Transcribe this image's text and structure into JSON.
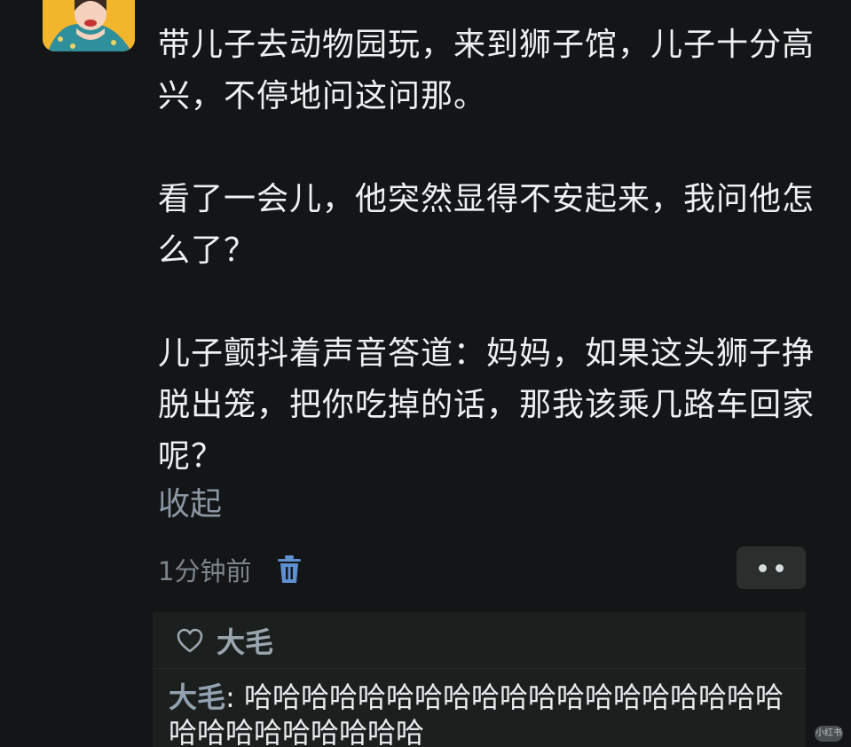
{
  "post": {
    "paragraphs": [
      "带儿子去动物园玩，来到狮子馆，儿子十分高兴，不停地问这问那。",
      "看了一会儿，他突然显得不安起来，我问他怎么了？",
      "儿子颤抖着声音答道：妈妈，如果这头狮子挣脱出笼，把你吃掉的话，那我该乘几路车回家呢？"
    ],
    "collapse_label": "收起",
    "time": "1分钟前"
  },
  "icons": {
    "avatar": "avatar-image",
    "delete": "trash-icon",
    "more": "more-dots-icon",
    "like": "heart-icon"
  },
  "likes": {
    "names": "大毛"
  },
  "comments": [
    {
      "author": "大毛",
      "separator": ": ",
      "text": "哈哈哈哈哈哈哈哈哈哈哈哈哈哈哈哈哈哈哈哈哈哈哈哈哈哈哈哈"
    }
  ],
  "watermark": "小红书",
  "colors": {
    "background": "#131516",
    "text": "#eef0f1",
    "link": "#8b97a3",
    "author": "#93a2b0"
  }
}
